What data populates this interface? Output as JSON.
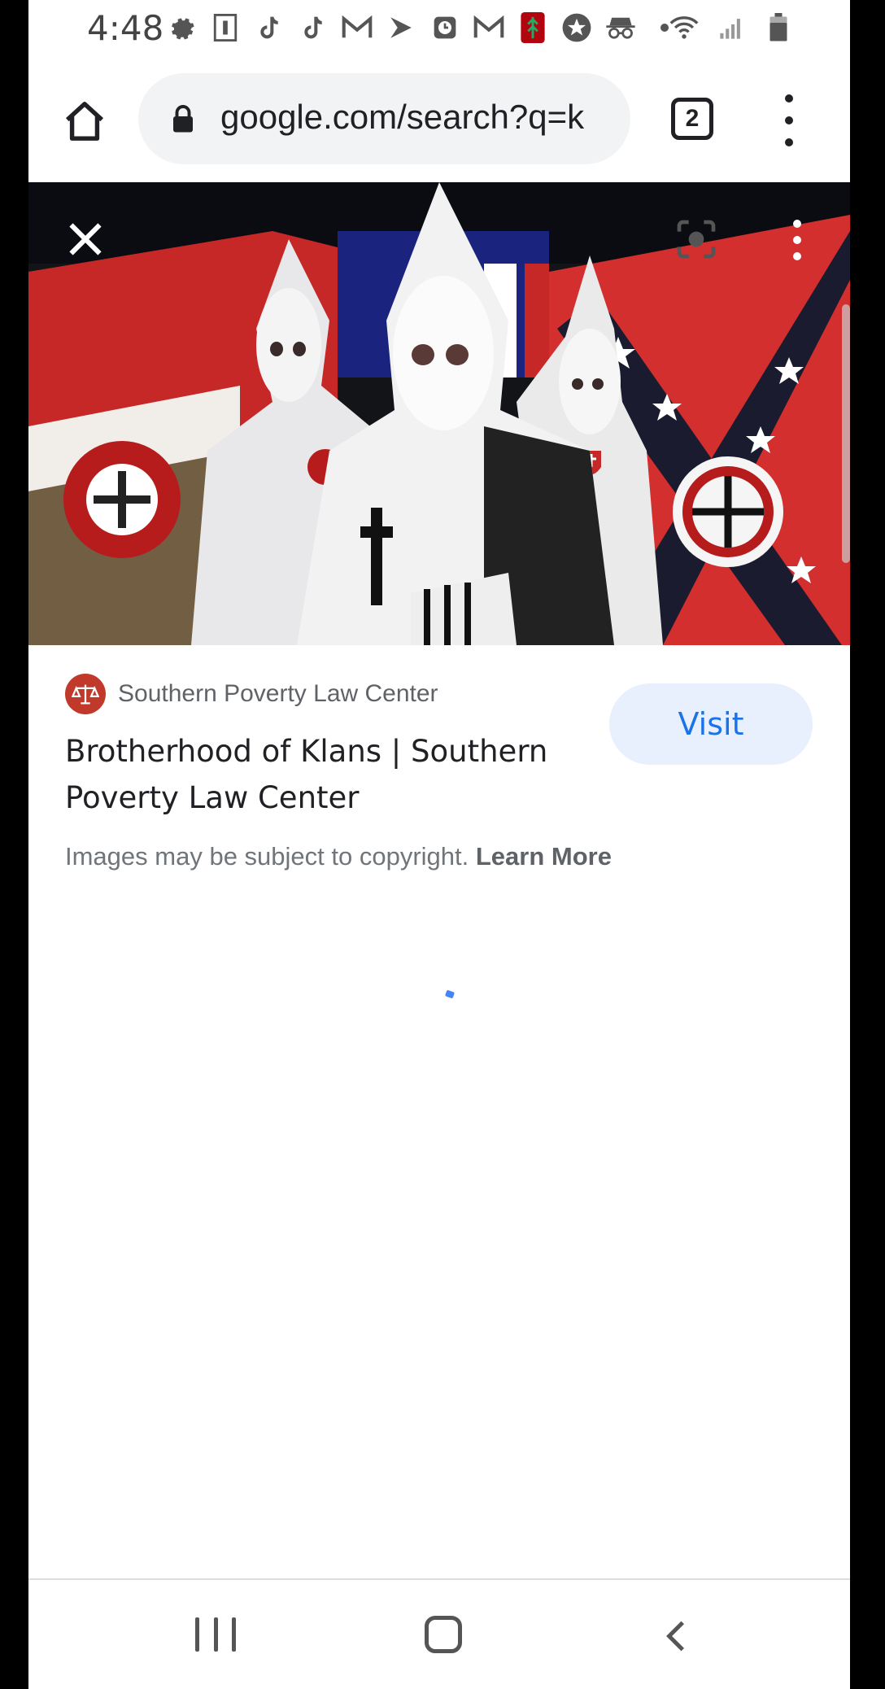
{
  "status_bar": {
    "time": "4:48",
    "notification_icons": [
      "settings-gear-icon",
      "app-icon",
      "tiktok-icon",
      "tiktok-icon",
      "gmail-icon",
      "sprint-icon",
      "clock-app-icon",
      "gmail-icon",
      "stanford-icon",
      "star-icon",
      "incognito-icon",
      "more-dot-icon"
    ],
    "right_icons": [
      "wifi-icon",
      "signal-icon",
      "battery-icon"
    ]
  },
  "browser": {
    "url": "google.com/search?q=k",
    "tab_count": "2"
  },
  "viewer": {
    "image_subject": "photo-of-hooded-figures-with-flags"
  },
  "result": {
    "source_name": "Southern Poverty Law Center",
    "title": "Brotherhood of Klans | Southern Poverty Law Center",
    "visit_label": "Visit",
    "copyright_text": "Images may be subject to copyright. ",
    "learn_more_label": "Learn More"
  },
  "colors": {
    "accent": "#1a73e8",
    "visit_bg": "#e8f0fe",
    "source_logo": "#c0392b"
  }
}
